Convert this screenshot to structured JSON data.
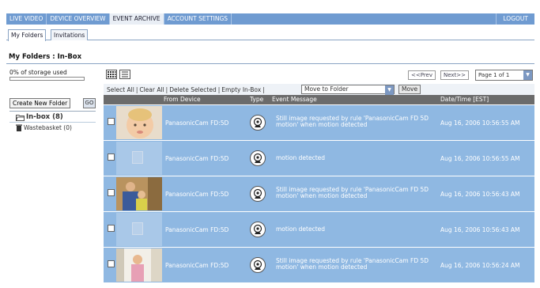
{
  "topnav": {
    "items": [
      "LIVE VIDEO",
      "DEVICE OVERVIEW",
      "EVENT ARCHIVE",
      "ACCOUNT SETTINGS"
    ],
    "active_index": 2,
    "logout": "LOGOUT"
  },
  "subtabs": [
    "My Folders",
    "Invitations"
  ],
  "page_title": "My Folders : In-Box",
  "storage": {
    "label": "0% of storage used",
    "used_percent": 0
  },
  "sidebar": {
    "create_folder_label": "Create New Folder",
    "go_label": "GO",
    "folders": [
      {
        "name": "In-box (8)",
        "icon": "open-folder-icon"
      },
      {
        "name": "Wastebasket (0)",
        "icon": "trash-icon"
      }
    ]
  },
  "pager": {
    "prev": "<<Prev",
    "next": "Next>>",
    "page": "Page 1 of 1"
  },
  "actions": {
    "select_all": "Select All",
    "clear_all": "Clear All",
    "delete_selected": "Delete Selected",
    "empty_inbox": "Empty In-Box",
    "move_to_folder": "Move to Folder",
    "move_button": "Move"
  },
  "table": {
    "headers": {
      "device": "From Device",
      "type": "Type",
      "message": "Event Message",
      "date": "Date/Time [EST]"
    },
    "rows": [
      {
        "thumb": "photo",
        "device": "PanasonicCam FD:5D",
        "message": "Still image requested by rule 'PanasonicCam FD 5D motion' when motion detected",
        "date": "Aug 16, 2006 10:56:55 AM"
      },
      {
        "thumb": "document",
        "device": "PanasonicCam FD:5D",
        "message": "motion detected",
        "date": "Aug 16, 2006 10:56:55 AM"
      },
      {
        "thumb": "photo",
        "device": "PanasonicCam FD:5D",
        "message": "Still image requested by rule 'PanasonicCam FD 5D motion' when motion detected",
        "date": "Aug 16, 2006 10:56:43 AM"
      },
      {
        "thumb": "document",
        "device": "PanasonicCam FD:5D",
        "message": "motion detected",
        "date": "Aug 16, 2006 10:56:43 AM"
      },
      {
        "thumb": "photo",
        "device": "PanasonicCam FD:5D",
        "message": "Still image requested by rule 'PanasonicCam FD 5D motion' when motion detected",
        "date": "Aug 16, 2006 10:56:24 AM"
      }
    ]
  }
}
